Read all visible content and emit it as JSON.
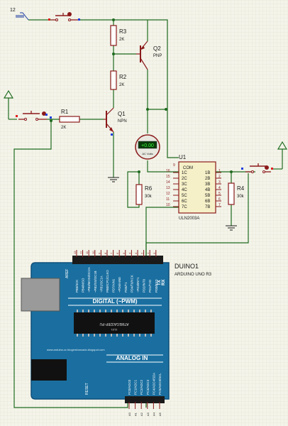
{
  "colors": {
    "background": "#f4f4ea",
    "grid": "#dcdccc",
    "wire": "#1f6b1f",
    "component": "#8b1a1a",
    "label": "#1a1a1a",
    "pin_number": "#8b1a1a",
    "arduino_board": "#1a6fa0",
    "arduino_dark": "#0f4f7a",
    "meter_display": "#0a3a0a",
    "meter_digits": "#39ff39",
    "pin_dot_red": "#e02020",
    "pin_dot_blue": "#2040e0"
  },
  "top_terminal": {
    "label": "12"
  },
  "left_terminal": {
    "label": ""
  },
  "resistors": {
    "r1": {
      "name": "R1",
      "value": "2K"
    },
    "r2": {
      "name": "R2",
      "value": "2K"
    },
    "r3": {
      "name": "R3",
      "value": "2K"
    },
    "r4": {
      "name": "R4",
      "value": "30k"
    },
    "r6": {
      "name": "R6",
      "value": "30k"
    }
  },
  "transistors": {
    "q1": {
      "name": "Q1",
      "type": "NPN"
    },
    "q2": {
      "name": "Q2",
      "type": "PNP"
    }
  },
  "voltmeter": {
    "reading": "+0.00",
    "unit": "AC Volts"
  },
  "ic": {
    "ref": "U1",
    "part": "ULN2003A",
    "com_label": "COM",
    "com_pin": "9",
    "inputs": [
      {
        "pin": "16",
        "label": "1C"
      },
      {
        "pin": "15",
        "label": "2C"
      },
      {
        "pin": "14",
        "label": "3C"
      },
      {
        "pin": "13",
        "label": "4C"
      },
      {
        "pin": "12",
        "label": "5C"
      },
      {
        "pin": "11",
        "label": "6C"
      },
      {
        "pin": "10",
        "label": "7C"
      }
    ],
    "outputs": [
      {
        "pin": "1",
        "label": "1B"
      },
      {
        "pin": "2",
        "label": "2B"
      },
      {
        "pin": "3",
        "label": "3B"
      },
      {
        "pin": "4",
        "label": "4B"
      },
      {
        "pin": "5",
        "label": "5B"
      },
      {
        "pin": "6",
        "label": "6B"
      },
      {
        "pin": "7",
        "label": "7B"
      }
    ]
  },
  "arduino": {
    "ref": "DUINO1",
    "model": "ARDUINO UNO R3",
    "digital_label": "DIGITAL (~PWM)",
    "analog_label": "ANALOG IN",
    "chip_text": "ATMEGA328P-PU",
    "chip_subtext": "1121",
    "url_text": "www.arduino.cc  blogembarcado.blogspot.com",
    "aref_label": "AREF",
    "reset_label": "RESET",
    "tx_label": "TX",
    "rx_label": "RX",
    "top_pin_numbers": [
      "13",
      "12",
      "11",
      "10",
      "9",
      "8",
      "7",
      "6",
      "5",
      "4",
      "3",
      "2",
      "1",
      "0"
    ],
    "top_pin_labels": [
      "PB5/SCK",
      "PB4/MISO",
      "~PB3/MOSI/OC2A",
      "~PB2/SS/OC1B",
      "~PB1/OC1A",
      "PB0/ICP1/CLKO",
      "PD7/AIN1",
      "~PD6/AIN0",
      "PD5/T1",
      "PD4/T0/XCK",
      "~PD3/INT1",
      "PD2/INT0",
      "PD1/TXD",
      "PD0/RXD"
    ],
    "bottom_pin_labels": [
      "PC0/ADC0",
      "PC1/ADC1",
      "PC2/ADC2",
      "PC3/ADC3",
      "PC4/ADC4/SDA",
      "PC5/ADC5/SCL"
    ],
    "bottom_pin_numbers": [
      "A0",
      "A1",
      "A2",
      "A3",
      "A4",
      "A5"
    ]
  }
}
